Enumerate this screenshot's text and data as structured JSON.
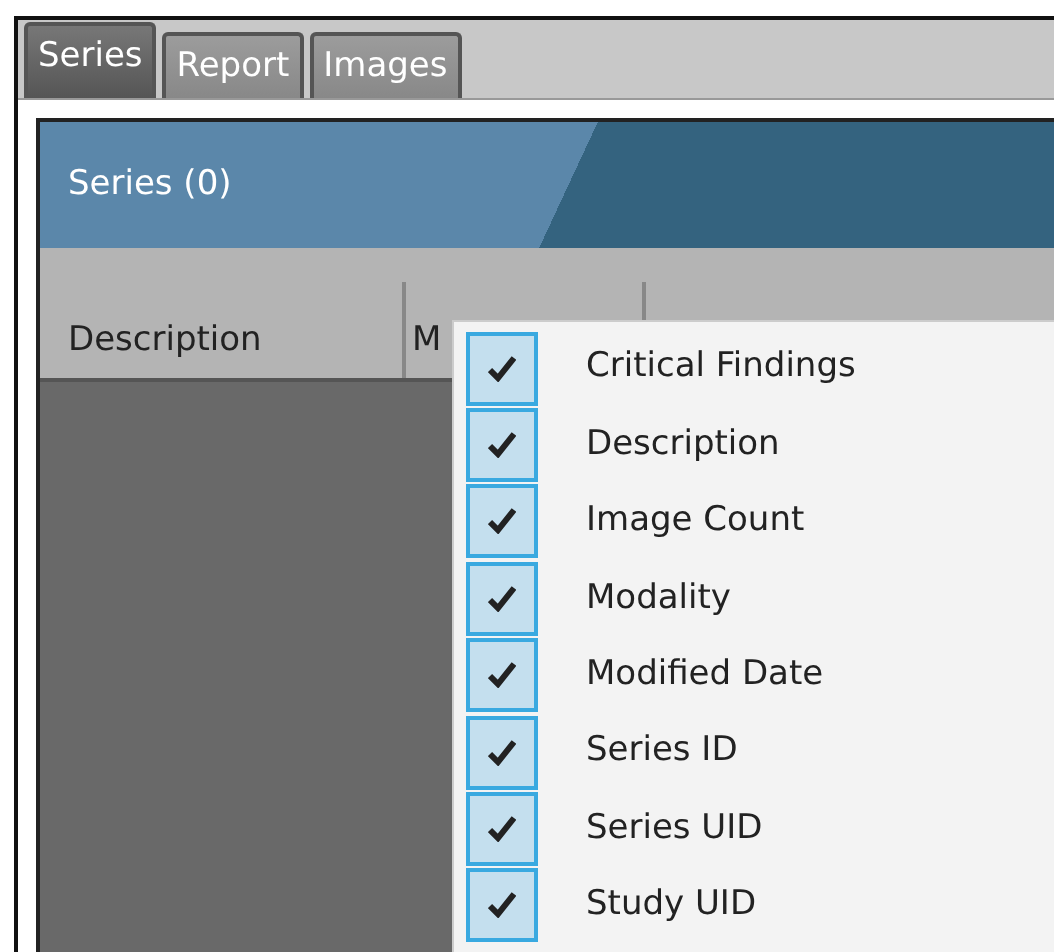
{
  "tabs": [
    {
      "label": "Series",
      "selected": true
    },
    {
      "label": "Report",
      "selected": false
    },
    {
      "label": "Images",
      "selected": false
    }
  ],
  "panel": {
    "title": "Series (0)"
  },
  "table": {
    "columns": [
      "Description",
      "M"
    ]
  },
  "context_menu": {
    "items": [
      {
        "label": "Critical Findings",
        "checked": true
      },
      {
        "label": "Description",
        "checked": true
      },
      {
        "label": "Image Count",
        "checked": true
      },
      {
        "label": "Modality",
        "checked": true
      },
      {
        "label": "Modified Date",
        "checked": true
      },
      {
        "label": "Series ID",
        "checked": true
      },
      {
        "label": "Series UID",
        "checked": true
      },
      {
        "label": "Study UID",
        "checked": true
      }
    ]
  }
}
